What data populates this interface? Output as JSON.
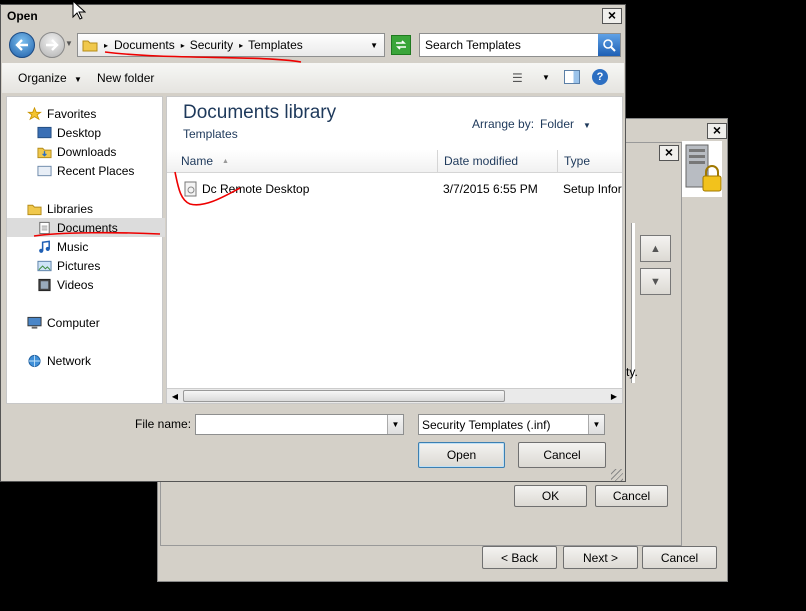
{
  "back_dialog": {
    "ok_label": "OK",
    "cancel_label": "Cancel",
    "back_label": "< Back",
    "next_label": "Next >",
    "cancel2_label": "Cancel",
    "partial_text": "ty."
  },
  "open_dialog": {
    "title": "Open",
    "breadcrumb": [
      "Documents",
      "Security",
      "Templates"
    ],
    "search_placeholder": "Search Templates",
    "toolbar": {
      "organize": "Organize",
      "new_folder": "New folder"
    },
    "nav": {
      "favorites": "Favorites",
      "desktop": "Desktop",
      "downloads": "Downloads",
      "recent_places": "Recent Places",
      "libraries": "Libraries",
      "documents": "Documents",
      "music": "Music",
      "pictures": "Pictures",
      "videos": "Videos",
      "computer": "Computer",
      "network": "Network"
    },
    "library": {
      "title": "Documents library",
      "subtitle": "Templates",
      "arrange_by_label": "Arrange by:",
      "arrange_by_value": "Folder"
    },
    "columns": {
      "name": "Name",
      "date": "Date modified",
      "type": "Type"
    },
    "files": [
      {
        "name": "Dc Remote Desktop",
        "date": "3/7/2015 6:55 PM",
        "type": "Setup Inform"
      }
    ],
    "file_name_label": "File name:",
    "file_name_value": "",
    "filter_value": "Security Templates (.inf)",
    "open_label": "Open",
    "cancel_label": "Cancel"
  },
  "colors": {
    "accent": "#3c7fb1",
    "annotation": "#e00000",
    "chrome": "#d4d0c8"
  }
}
